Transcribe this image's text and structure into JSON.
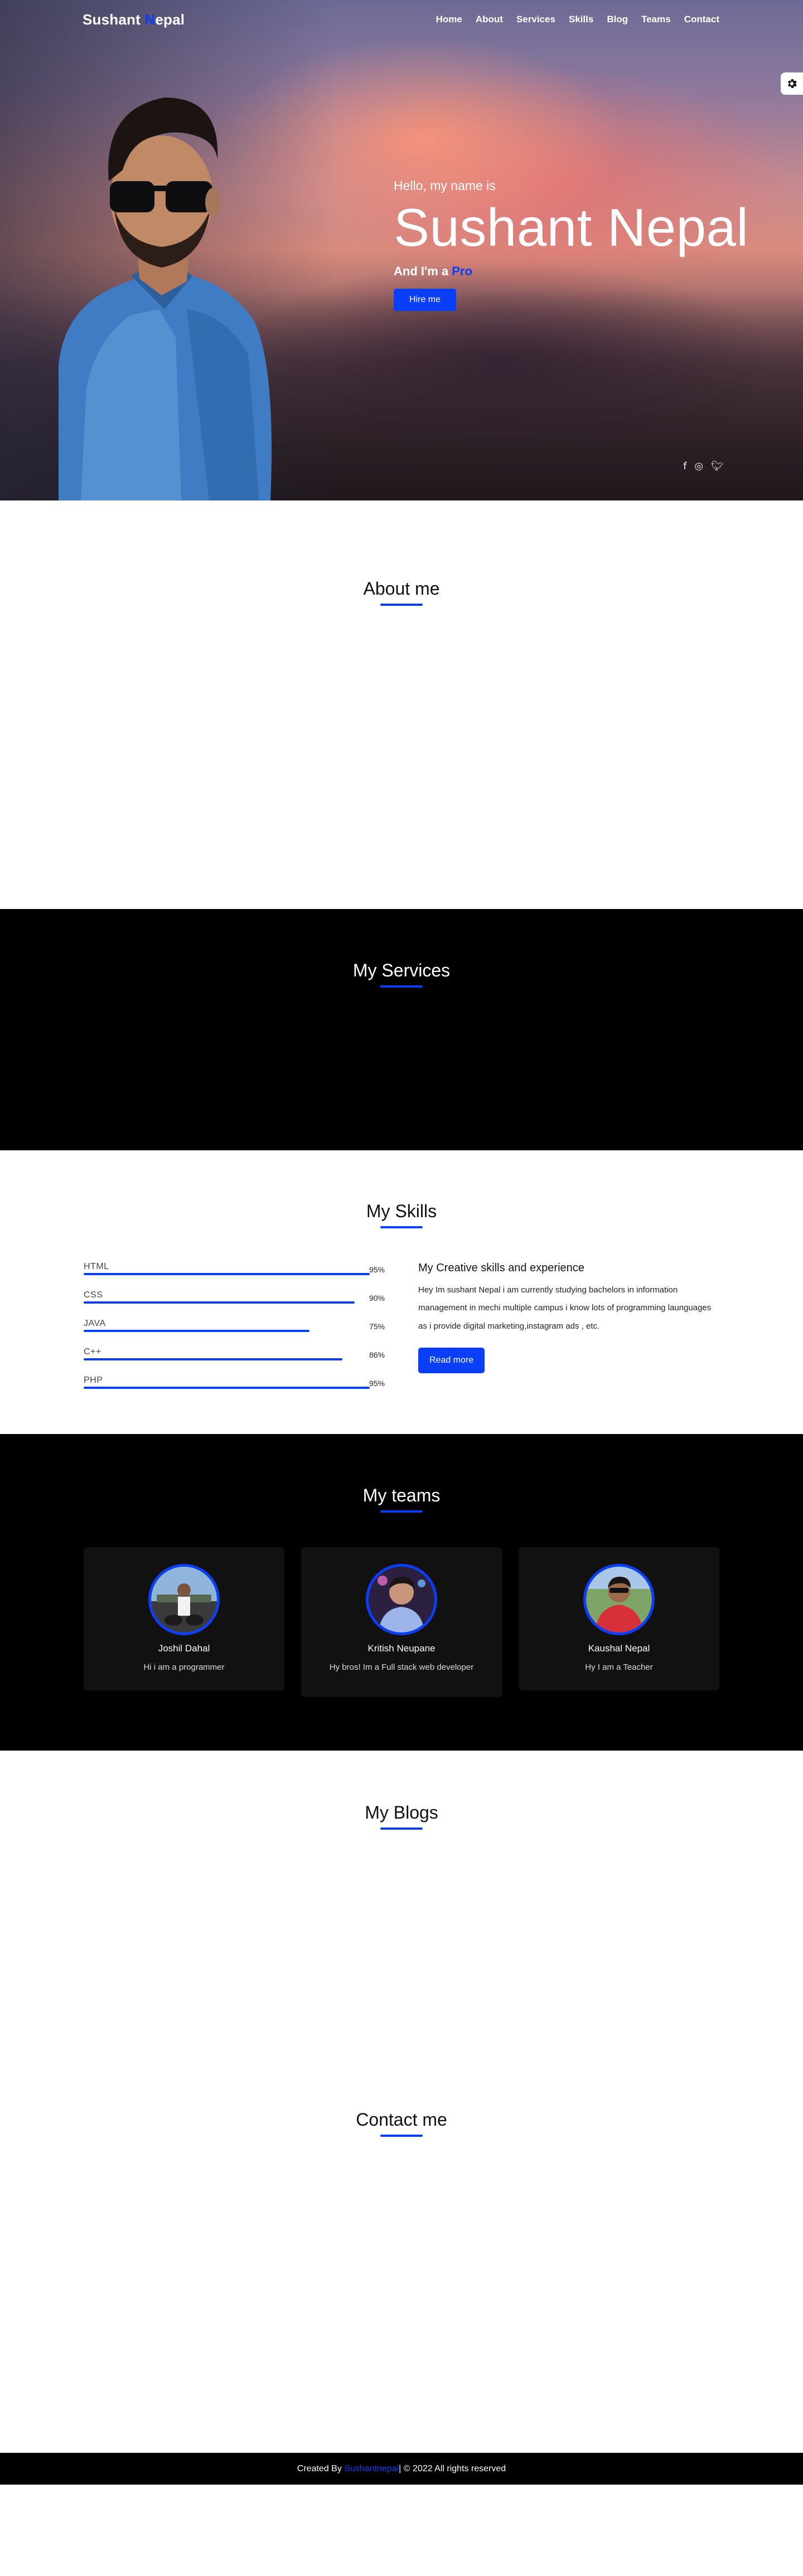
{
  "nav": {
    "brand_first": "Sushant ",
    "brand_accent": "N",
    "brand_rest": "epal",
    "links": [
      "Home",
      "About",
      "Services",
      "Skills",
      "Blog",
      "Teams",
      "Contact"
    ]
  },
  "hero": {
    "hello": "Hello, my name is",
    "name": "Sushant Nepal",
    "role_prefix": "And I'm a ",
    "role_typed": "Pro",
    "hire_label": "Hire me",
    "social_icons": [
      "facebook-icon",
      "instagram-icon",
      "twitter-icon"
    ]
  },
  "about": {
    "title": "About me"
  },
  "services": {
    "title": "My Services"
  },
  "skills": {
    "title": "My Skills",
    "items": [
      {
        "name": "HTML",
        "percent_label": "95%",
        "percent": 95
      },
      {
        "name": "CSS",
        "percent_label": "90%",
        "percent": 90
      },
      {
        "name": "JAVA",
        "percent_label": "75%",
        "percent": 75
      },
      {
        "name": "C++",
        "percent_label": "86%",
        "percent": 86
      },
      {
        "name": "PHP",
        "percent_label": "95%",
        "percent": 95
      }
    ],
    "heading": "My Creative skills and experience",
    "paragraph": "Hey Im sushant Nepal i am currently studying bachelors in information management in mechi multiple campus i know lots of programming launguages as i provide digital marketing,instagram ads , etc.",
    "read_more": "Read more"
  },
  "teams": {
    "title": "My teams",
    "members": [
      {
        "name": "Joshil Dahal",
        "desc": "Hi i am a programmer"
      },
      {
        "name": "Kritish Neupane",
        "desc": "Hy bros! Im a Full stack web developer"
      },
      {
        "name": "Kaushal Nepal",
        "desc": "Hy I am a Teacher"
      }
    ]
  },
  "blogs": {
    "title": "My Blogs"
  },
  "contact": {
    "title": "Contact me"
  },
  "footer": {
    "prefix": "Created By ",
    "author": "Sushantnepal",
    "suffix": " | © 2022 All rights reserved"
  },
  "colors": {
    "accent": "#0b3ef7",
    "dark": "#000000",
    "card": "#111111"
  }
}
